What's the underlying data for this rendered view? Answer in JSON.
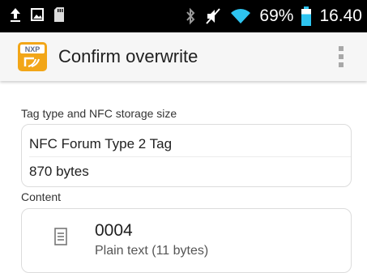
{
  "status_bar": {
    "battery_percent_label": "69%",
    "time": "16.40",
    "icons": [
      "upload-icon",
      "image-icon",
      "sd-card-icon",
      "bluetooth-icon",
      "mute-icon",
      "wifi-icon",
      "battery-icon"
    ],
    "battery_level": 0.69
  },
  "app_bar": {
    "title": "Confirm overwrite",
    "logo_text": "NXP"
  },
  "tag_section": {
    "label": "Tag type and NFC storage size",
    "tag_type": "NFC Forum Type 2 Tag",
    "storage_size": "870 bytes"
  },
  "content_section": {
    "label": "Content",
    "record_title": "0004",
    "record_subtitle": "Plain text (11 bytes)"
  },
  "colors": {
    "status_bar_bg": "#000000",
    "app_bar_bg": "#f6f6f6",
    "logo_orange": "#f2a618",
    "battery_accent": "#2ec4f0"
  }
}
